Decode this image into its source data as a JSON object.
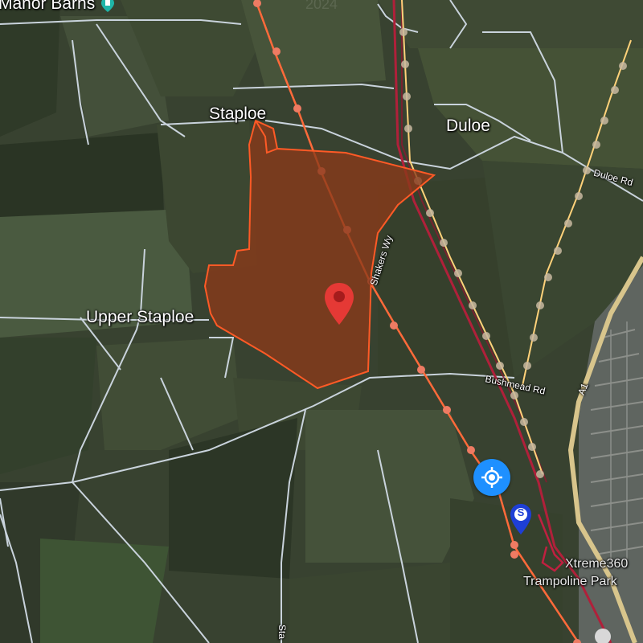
{
  "map": {
    "labels": {
      "manor_barns": "Manor Barns",
      "staploe": "Staploe",
      "duloe": "Duloe",
      "upper_staploe": "Upper Staploe",
      "duloe_rd": "Duloe Rd",
      "shakers_wy": "Shakers Wy",
      "bushmead_rd": "Bushmead Rd",
      "a1": "A1",
      "xtreme": "Xtreme360",
      "trampoline": "Trampoline Park",
      "sta_road": "Sta",
      "faint_year": "2024"
    },
    "marker": {
      "name": "location-pin",
      "color": "#e53935"
    },
    "area": {
      "fill": "#8a3a1a",
      "stroke": "#ff5a26"
    },
    "routes": {
      "orange": "#ff6a3a",
      "yellow": "#ffd27a",
      "crimson": "#b0203a"
    },
    "controls": {
      "locate_icon": "crosshair-icon",
      "locate_color": "#1e90ff",
      "s_badge": "S",
      "s_color": "#1e3fd6"
    }
  }
}
